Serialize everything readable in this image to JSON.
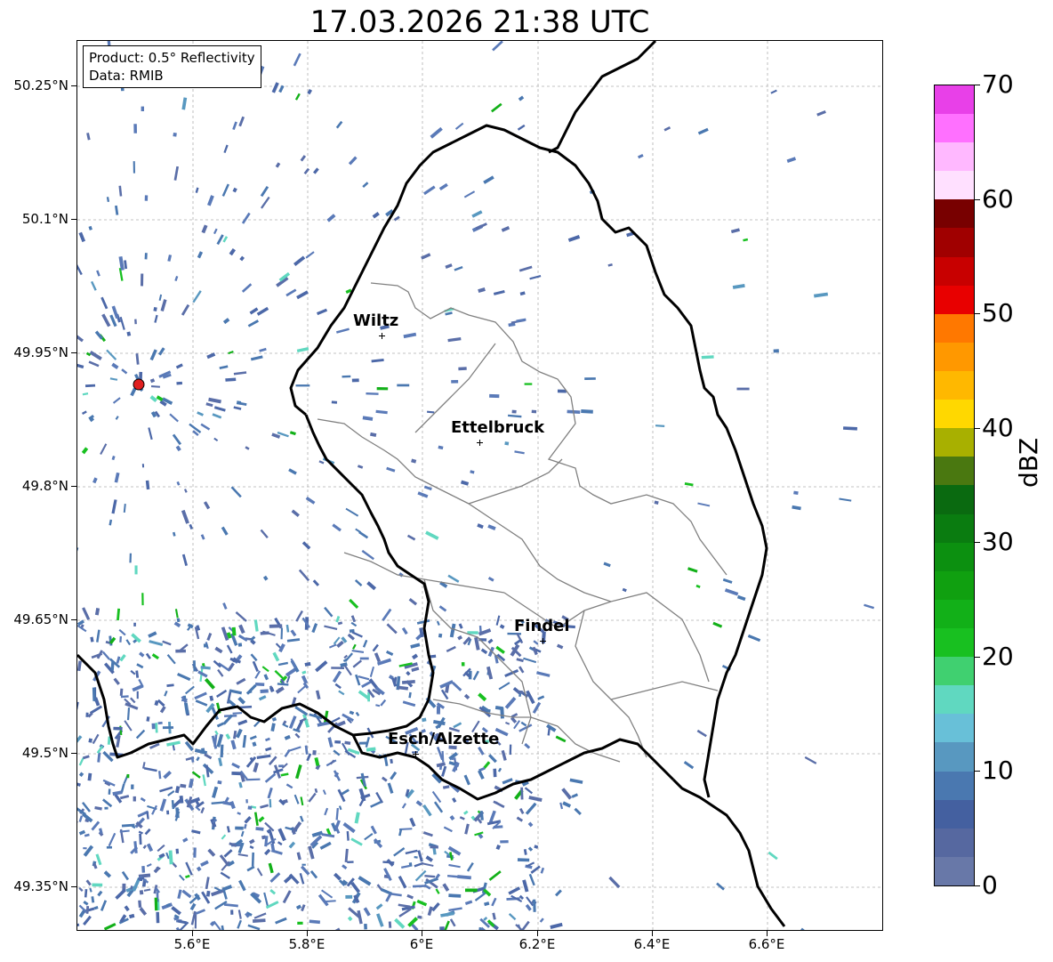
{
  "title": "17.03.2026 21:38 UTC",
  "info_box": {
    "product": "Product: 0.5° Reflectivity",
    "data": "Data: RMIB"
  },
  "lat_labels": [
    "50.25°N",
    "50.1°N",
    "49.95°N",
    "49.8°N",
    "49.65°N",
    "49.5°N",
    "49.35°N"
  ],
  "lon_labels": [
    "5.6°E",
    "5.8°E",
    "6°E",
    "6.2°E",
    "6.4°E",
    "6.6°E"
  ],
  "cities": [
    {
      "name": "Wiltz"
    },
    {
      "name": "Ettelbruck"
    },
    {
      "name": "Findel"
    },
    {
      "name": "Esch/Alzette"
    }
  ],
  "colorbar": {
    "label": "dBZ",
    "ticks": [
      "0",
      "10",
      "20",
      "30",
      "40",
      "50",
      "60",
      "70"
    ],
    "colors": [
      "#6878a8",
      "#5668a0",
      "#4460a0",
      "#4a78b0",
      "#5898c0",
      "#68c0d8",
      "#60d8c0",
      "#40d070",
      "#18c020",
      "#12b018",
      "#10a010",
      "#0c9010",
      "#0a7c10",
      "#0a6a10",
      "#4a7810",
      "#a8b000",
      "#ffd800",
      "#ffb800",
      "#ff9800",
      "#ff7800",
      "#e80000",
      "#c80000",
      "#a00000",
      "#780000",
      "#ffe0ff",
      "#ffb8ff",
      "#ff70ff",
      "#e840e8"
    ]
  },
  "radar_site_color": "#e02020"
}
